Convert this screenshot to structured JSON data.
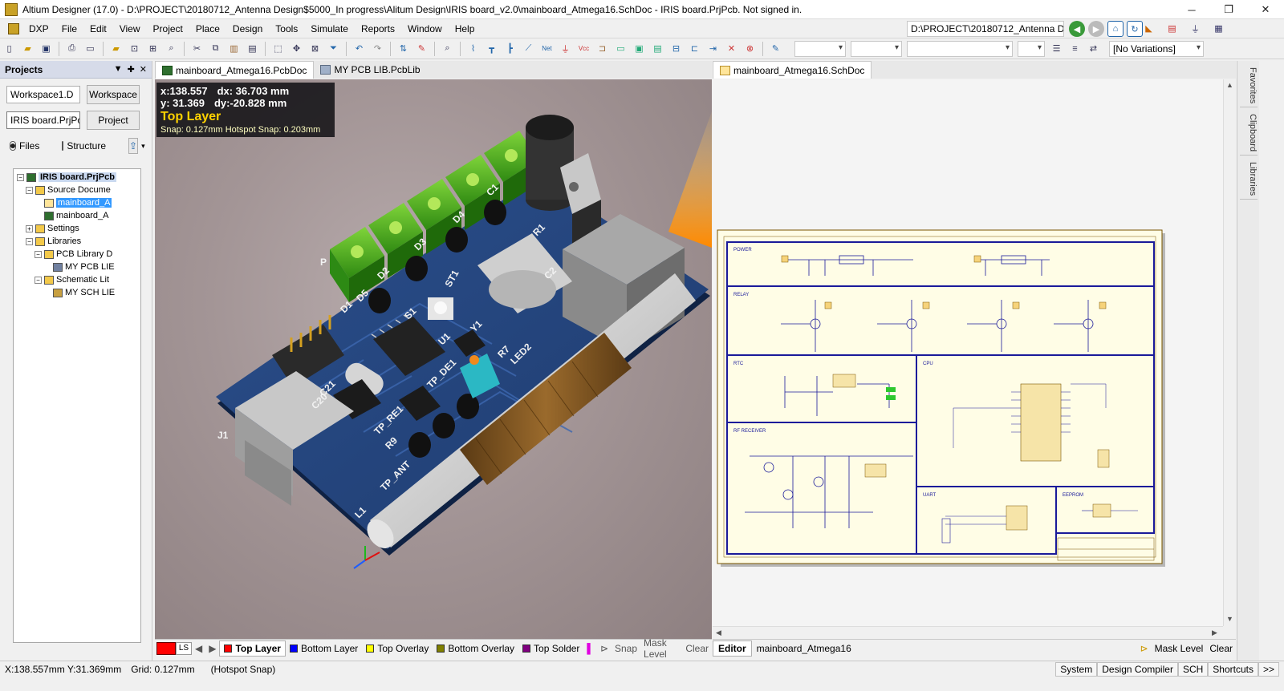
{
  "window": {
    "title": "Altium Designer (17.0) - D:\\PROJECT\\20180712_Antenna Design$5000_In progress\\Alitum Design\\IRIS board_v2.0\\mainboard_Atmega16.SchDoc - IRIS board.PrjPcb. Not signed in.",
    "minimize": "─",
    "maximize": "❐",
    "close": "✕"
  },
  "menu": {
    "items": [
      "DXP",
      "File",
      "Edit",
      "View",
      "Project",
      "Place",
      "Design",
      "Tools",
      "Simulate",
      "Reports",
      "Window",
      "Help"
    ],
    "path": "D:\\PROJECT\\20180712_Antenna De"
  },
  "toolbar": {
    "variations": "[No Variations]"
  },
  "projects": {
    "panel_title": "Projects",
    "workspace_combo": "Workspace1.D",
    "workspace_button": "Workspace",
    "project_combo": "IRIS board.PrjPcb",
    "project_button": "Project",
    "view_files": "Files",
    "view_structure": "Structure",
    "tree": [
      {
        "label": "IRIS board.PrjPcb",
        "level": 0,
        "kind": "root",
        "expander": "−"
      },
      {
        "label": "Source Docume",
        "level": 1,
        "kind": "folder",
        "expander": "−"
      },
      {
        "label": "mainboard_A",
        "level": 2,
        "kind": "sch",
        "expander": "",
        "selected": true
      },
      {
        "label": "mainboard_A",
        "level": 2,
        "kind": "pcb",
        "expander": ""
      },
      {
        "label": "Settings",
        "level": 1,
        "kind": "folder",
        "expander": "+"
      },
      {
        "label": "Libraries",
        "level": 1,
        "kind": "folder",
        "expander": "−"
      },
      {
        "label": "PCB Library D",
        "level": 2,
        "kind": "folder",
        "expander": "−"
      },
      {
        "label": "MY PCB LIE",
        "level": 3,
        "kind": "pcblib",
        "expander": ""
      },
      {
        "label": "Schematic Lit",
        "level": 2,
        "kind": "folder",
        "expander": "−"
      },
      {
        "label": "MY SCH LIE",
        "level": 3,
        "kind": "schlib",
        "expander": ""
      }
    ]
  },
  "tabs_left": [
    {
      "label": "mainboard_Atmega16.PcbDoc",
      "kind": "pcb",
      "active": true
    },
    {
      "label": "MY PCB LIB.PcbLib",
      "kind": "lib",
      "active": false
    }
  ],
  "tabs_right": [
    {
      "label": "mainboard_Atmega16.SchDoc",
      "kind": "sch",
      "active": true
    }
  ],
  "pcb_overlay": {
    "x": "x:138.557",
    "dx": "dx: 36.703 mm",
    "y": "y: 31.369",
    "dy": "dy:-20.828  mm",
    "layer": "Top Layer",
    "snap": "Snap: 0.127mm Hotspot Snap: 0.203mm"
  },
  "pcb_labels": [
    "J1",
    "L1",
    "C1",
    "D3",
    "D4",
    "D2",
    "ST1",
    "S1",
    "Y1",
    "R7",
    "LED2",
    "TP_DE1",
    "TP_RE1",
    "TP_ANT",
    "R9",
    "C21",
    "C20",
    "D1",
    "D5",
    "P",
    "C2",
    "R1",
    "U1"
  ],
  "side_tabs": [
    "Favorites",
    "Clipboard",
    "Libraries"
  ],
  "schematic_blocks": [
    "POWER",
    "RELAY",
    "RTC",
    "CPU",
    "RF RECEIVER",
    "UART",
    "EEPROM"
  ],
  "layer_bar": {
    "ls": "LS",
    "layers": [
      {
        "label": "Top Layer",
        "color": "#ff0000",
        "active": true
      },
      {
        "label": "Bottom Layer",
        "color": "#0000ff",
        "active": false
      },
      {
        "label": "Top Overlay",
        "color": "#ffff00",
        "active": false
      },
      {
        "label": "Bottom Overlay",
        "color": "#808000",
        "active": false
      },
      {
        "label": "Top Solder",
        "color": "#800080",
        "active": false
      }
    ],
    "snap": "Snap",
    "mask": "Mask Level",
    "clear": "Clear"
  },
  "editor_bar": {
    "editor": "Editor",
    "doc": "mainboard_Atmega16",
    "mask": "Mask Level",
    "clear": "Clear"
  },
  "statusbar": {
    "coords": "X:138.557mm Y:31.369mm",
    "grid": "Grid: 0.127mm",
    "snap": "(Hotspot Snap)",
    "buttons": [
      "System",
      "Design Compiler",
      "SCH",
      "Shortcuts"
    ],
    "more": ">>"
  }
}
